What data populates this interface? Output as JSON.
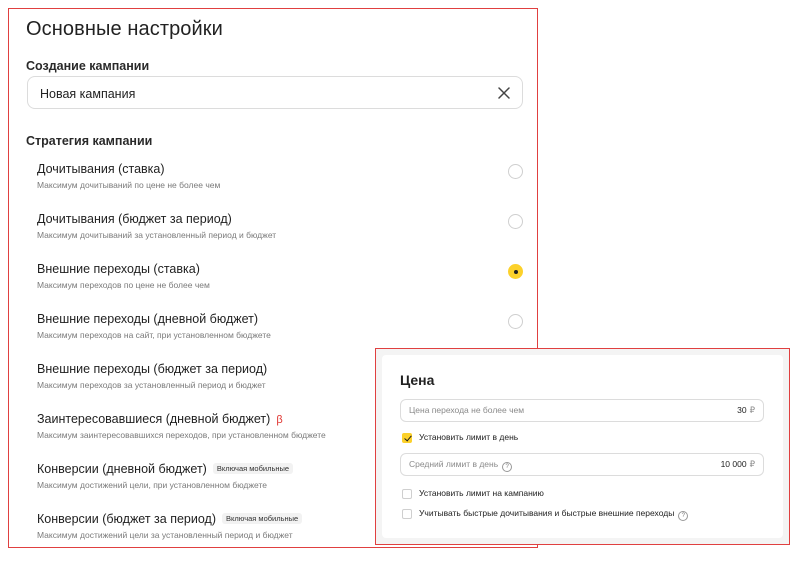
{
  "main": {
    "title": "Основные настройки",
    "creation_label": "Создание кампании",
    "campaign_name": "Новая кампания",
    "strategy_label": "Стратегия кампании",
    "strategies": [
      {
        "title": "Дочитывания (ставка)",
        "desc": "Максимум дочитываний по цене не более чем",
        "selected": false
      },
      {
        "title": "Дочитывания (бюджет за период)",
        "desc": "Максимум дочитываний за установленный период и бюджет",
        "selected": false
      },
      {
        "title": "Внешние переходы (ставка)",
        "desc": "Максимум переходов по цене не более чем",
        "selected": true
      },
      {
        "title": "Внешние переходы (дневной бюджет)",
        "desc": "Максимум переходов на сайт, при установленном бюджете",
        "selected": false
      },
      {
        "title": "Внешние переходы (бюджет за период)",
        "desc": "Максимум переходов за установленный период и бюджет",
        "selected": false
      },
      {
        "title": "Заинтересовавшиеся (дневной бюджет)",
        "desc": "Максимум заинтересовавшихся переходов, при установленном бюджете",
        "beta": "β"
      },
      {
        "title": "Конверсии (дневной бюджет)",
        "desc": "Максимум достижений цели, при установленном бюджете",
        "badge": "Включая мобильные"
      },
      {
        "title": "Конверсии (бюджет за период)",
        "desc": "Максимум достижений цели за установленный период и бюджет",
        "badge": "Включая мобильные"
      }
    ]
  },
  "price": {
    "title": "Цена",
    "cpc_placeholder": "Цена перехода не более чем",
    "cpc_value": "30",
    "currency": "₽",
    "daily_limit_label": "Установить лимит в день",
    "daily_limit_checked": true,
    "avg_limit_placeholder": "Средний лимит в день",
    "avg_limit_value": "10 000",
    "campaign_limit_label": "Установить лимит на кампанию",
    "campaign_limit_checked": false,
    "fast_reads_label": "Учитывать быстрые дочитывания и быстрые внешние переходы",
    "fast_reads_checked": false
  },
  "colors": {
    "accent": "#fcd12b",
    "frame": "#e04040",
    "beta": "#e0332e"
  }
}
